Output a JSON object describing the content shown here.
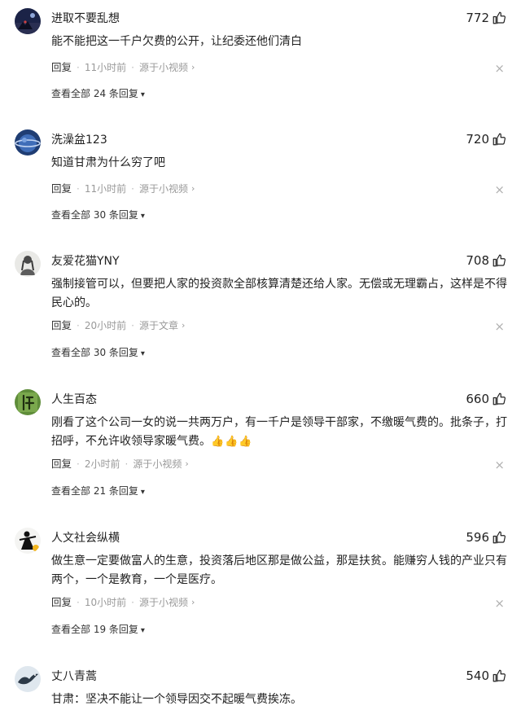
{
  "comments": [
    {
      "username": "进取不要乱想",
      "likes": "772",
      "text": "能不能把这一千户欠费的公开，让纪委还他们清白",
      "emoji": "",
      "reply_label": "回复",
      "time": "11小时前",
      "source": "源于小视频",
      "view_all": "查看全部 24 条回复",
      "avatar": "night-sky"
    },
    {
      "username": "洗澡盆123",
      "likes": "720",
      "text": "知道甘肃为什么穷了吧",
      "emoji": "",
      "reply_label": "回复",
      "time": "11小时前",
      "source": "源于小视频",
      "view_all": "查看全部 30 条回复",
      "avatar": "planet"
    },
    {
      "username": "友爱花猫YNY",
      "likes": "708",
      "text": "强制接管可以，但要把人家的投资款全部核算清楚还给人家。无偿或无理霸占，这样是不得民心的。",
      "emoji": "",
      "reply_label": "回复",
      "time": "20小时前",
      "source": "源于文章",
      "view_all": "查看全部 30 条回复",
      "avatar": "person-gray"
    },
    {
      "username": "人生百态",
      "likes": "660",
      "text": "刚看了这个公司一女的说一共两万户，有一千户是领导干部家，不缴暖气费的。批条子，打招呼，不允许收领导家暖气费。",
      "emoji": "👍👍👍",
      "reply_label": "回复",
      "time": "2小时前",
      "source": "源于小视频",
      "view_all": "查看全部 21 条回复",
      "avatar": "green-calligraphy"
    },
    {
      "username": "人文社会纵横",
      "likes": "596",
      "text": "做生意一定要做富人的生意，投资落后地区那是做公益，那是扶贫。能赚穷人钱的产业只有两个，一个是教育，一个是医疗。",
      "emoji": "",
      "reply_label": "回复",
      "time": "10小时前",
      "source": "源于小视频",
      "view_all": "查看全部 19 条回复",
      "avatar": "ink-figure"
    },
    {
      "username": "丈八青蒿",
      "likes": "540",
      "text": "甘肃：坚决不能让一个领导因交不起暖气费挨冻。",
      "emoji": "",
      "reply_label": "",
      "time": "",
      "source": "",
      "view_all": "",
      "avatar": "bird"
    }
  ]
}
